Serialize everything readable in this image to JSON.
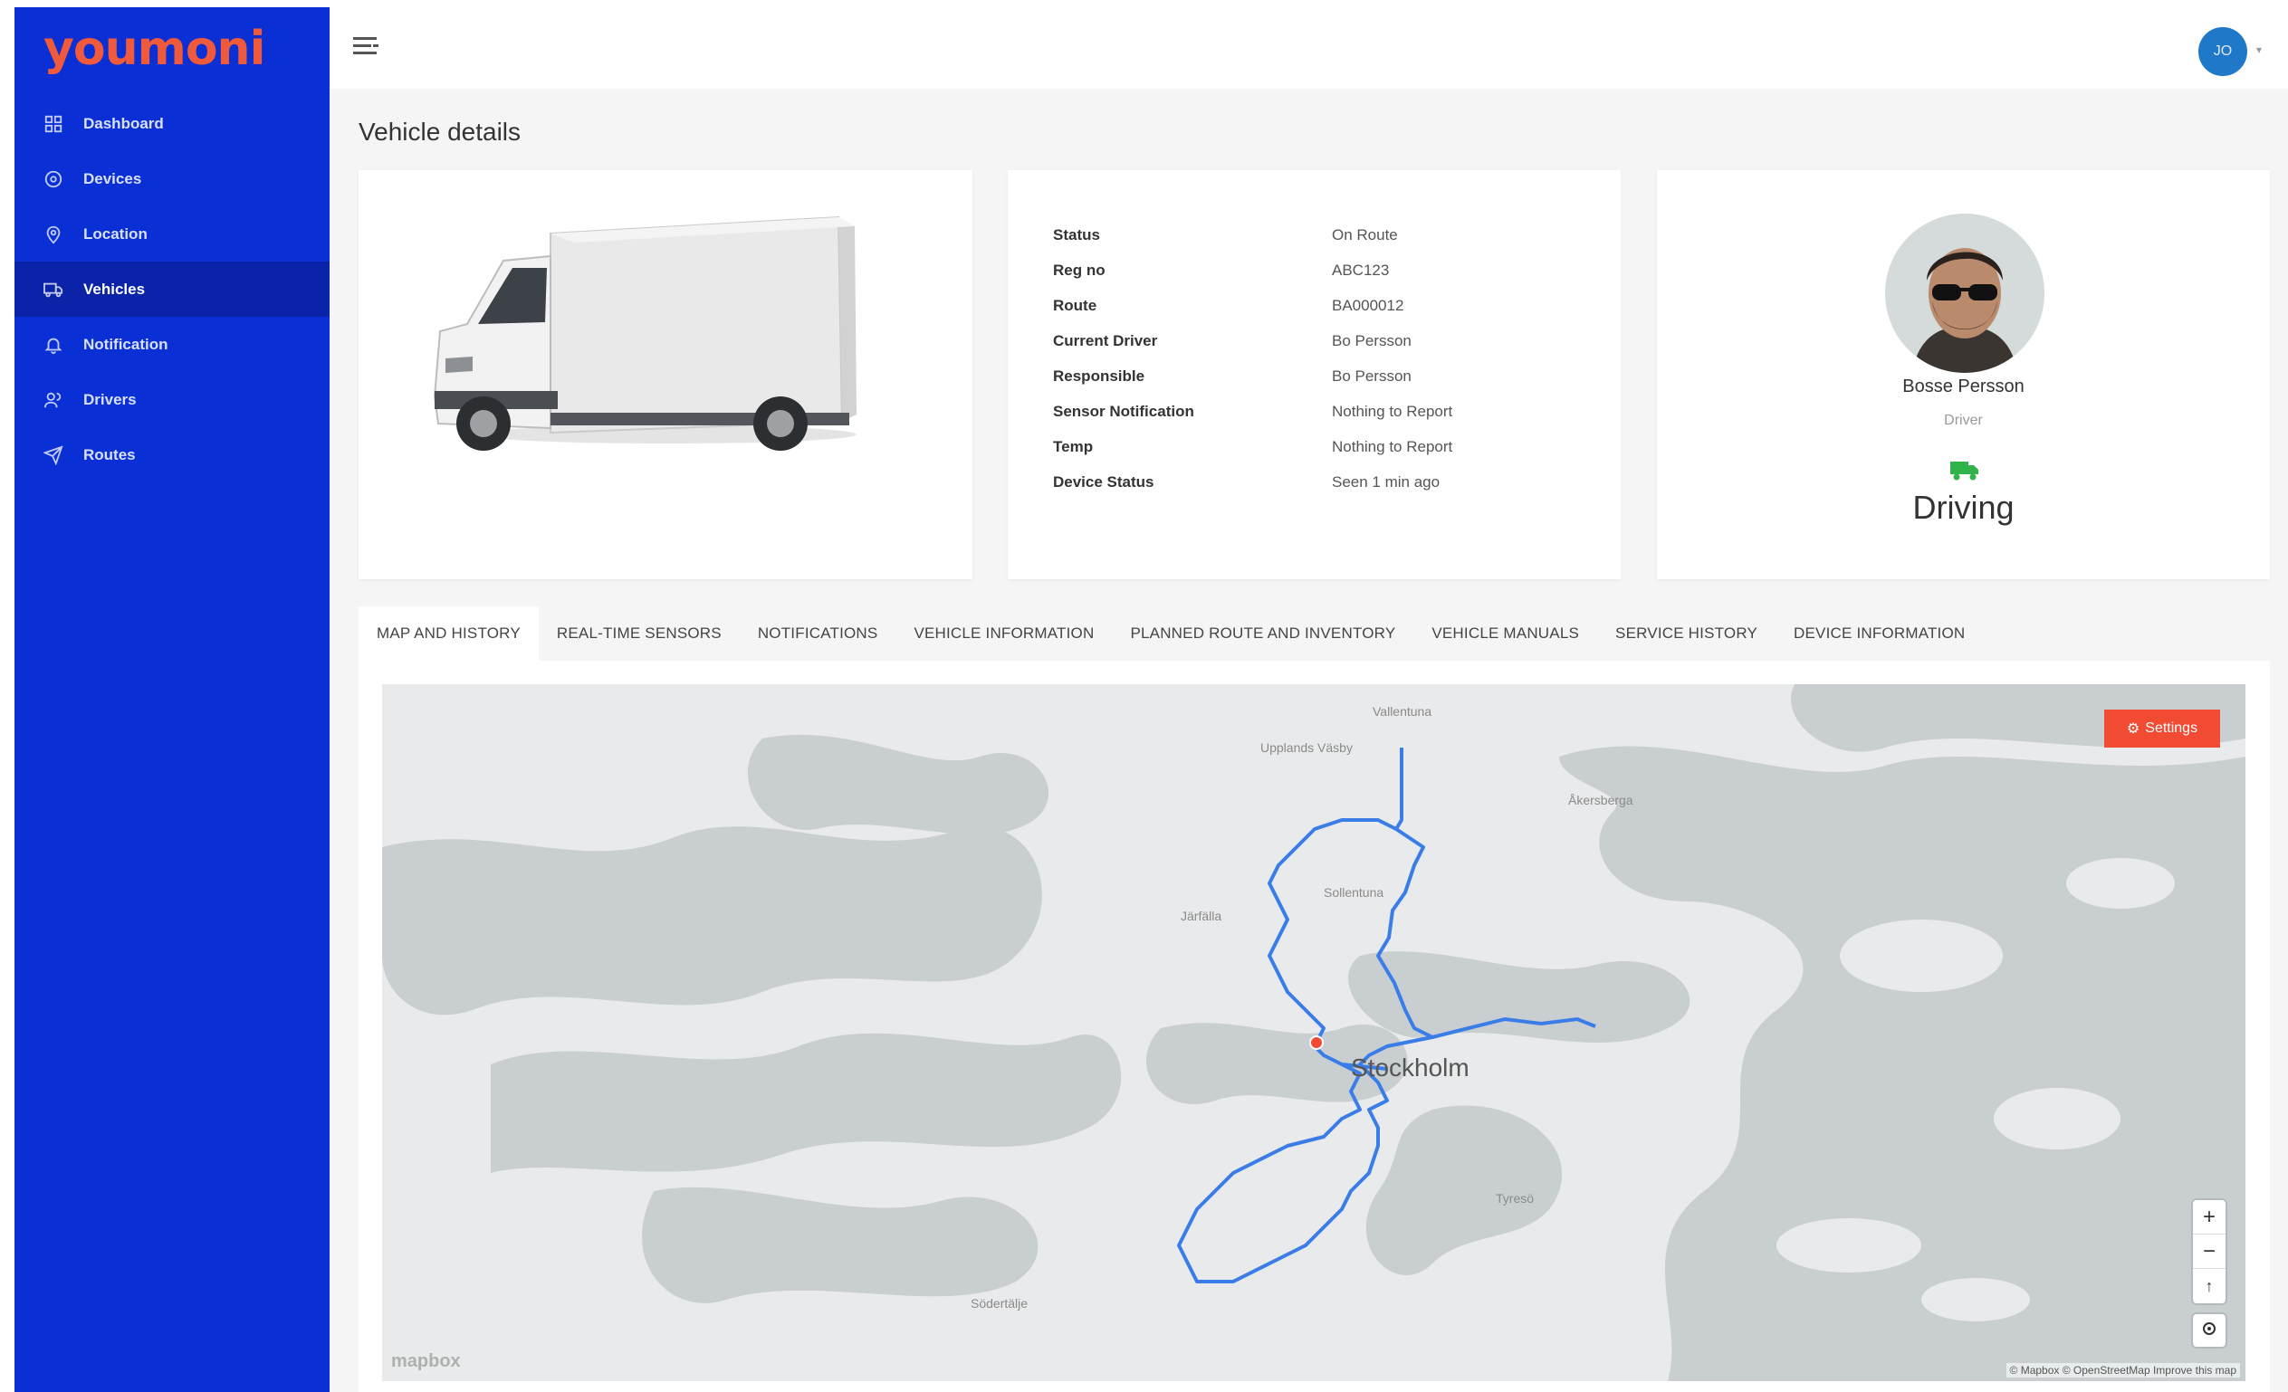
{
  "brand": {
    "logo_text": "youmoni"
  },
  "sidebar": {
    "items": [
      {
        "label": "Dashboard",
        "icon": "dashboard-icon"
      },
      {
        "label": "Devices",
        "icon": "devices-icon"
      },
      {
        "label": "Location",
        "icon": "location-pin-icon"
      },
      {
        "label": "Vehicles",
        "icon": "truck-icon",
        "active": true
      },
      {
        "label": "Notification",
        "icon": "bell-icon"
      },
      {
        "label": "Drivers",
        "icon": "users-icon"
      },
      {
        "label": "Routes",
        "icon": "send-icon"
      }
    ]
  },
  "header": {
    "avatar_initials": "JO"
  },
  "page": {
    "title": "Vehicle details"
  },
  "details": {
    "rows": [
      {
        "label": "Status",
        "value": "On Route"
      },
      {
        "label": "Reg no",
        "value": "ABC123"
      },
      {
        "label": "Route",
        "value": "BA000012"
      },
      {
        "label": "Current Driver",
        "value": "Bo Persson"
      },
      {
        "label": "Responsible",
        "value": "Bo Persson"
      },
      {
        "label": "Sensor Notification",
        "value": "Nothing to Report"
      },
      {
        "label": "Temp",
        "value": "Nothing to Report"
      },
      {
        "label": "Device Status",
        "value": "Seen 1 min ago"
      }
    ]
  },
  "driver": {
    "name": "Bosse Persson",
    "role": "Driver",
    "state": "Driving",
    "state_color": "#2fb34a"
  },
  "tabs": [
    {
      "label": "MAP AND HISTORY",
      "active": true
    },
    {
      "label": "REAL-TIME SENSORS"
    },
    {
      "label": "NOTIFICATIONS"
    },
    {
      "label": "VEHICLE INFORMATION"
    },
    {
      "label": "PLANNED ROUTE AND INVENTORY"
    },
    {
      "label": "VEHICLE MANUALS"
    },
    {
      "label": "SERVICE HISTORY"
    },
    {
      "label": "DEVICE INFORMATION"
    }
  ],
  "map": {
    "settings_label": "Settings",
    "city_label": "Stockholm",
    "place_labels": [
      "Vallentuna",
      "Upplands Väsby",
      "Åkersberga",
      "Södertälje",
      "Järfälla",
      "Sollentuna",
      "Tyresö"
    ],
    "zoom_in": "+",
    "zoom_out": "−",
    "compass": "↑",
    "logo": "mapbox",
    "attribution": "© Mapbox © OpenStreetMap  Improve this map",
    "route_color": "#3b7de8",
    "accent_color": "#f24b34"
  },
  "colors": {
    "sidebar": "#0a2fd4",
    "sidebar_active": "#0a23a8",
    "brand": "#f05a3c"
  }
}
